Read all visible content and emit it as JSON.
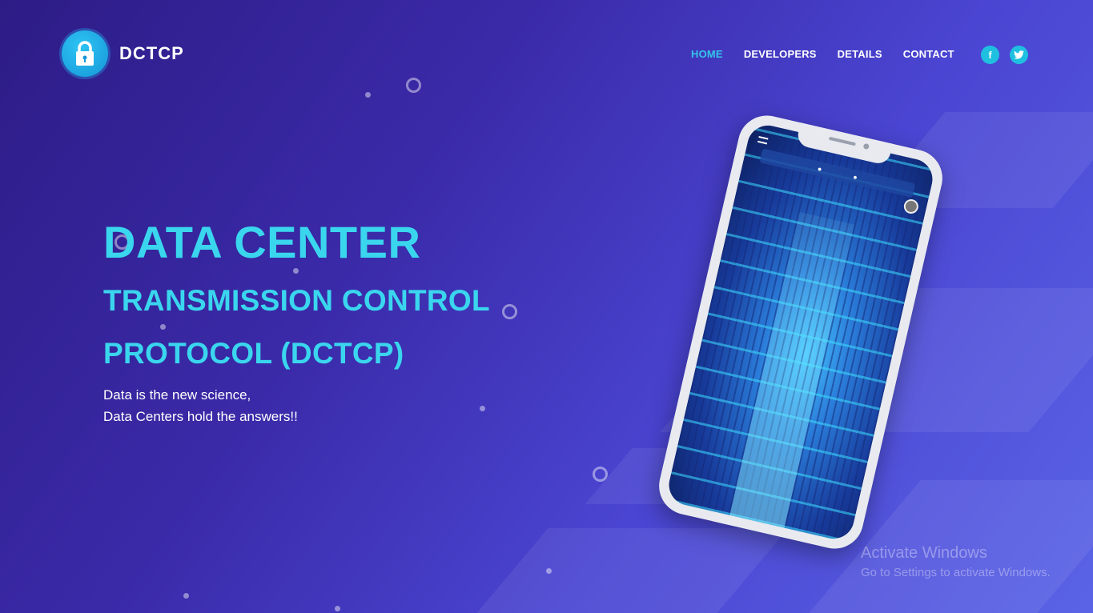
{
  "brand": {
    "name": "DCTCP",
    "logo_icon": "lock-icon"
  },
  "nav": {
    "items": [
      {
        "label": "HOME",
        "active": true
      },
      {
        "label": "DEVELOPERS",
        "active": false
      },
      {
        "label": "DETAILS",
        "active": false
      },
      {
        "label": "CONTACT",
        "active": false
      }
    ]
  },
  "social": {
    "facebook": "f",
    "twitter": "t"
  },
  "hero": {
    "title": "DATA CENTER",
    "subtitle_line1": "TRANSMISSION CONTROL",
    "subtitle_line2": "PROTOCOL (DCTCP)",
    "tagline_line1": "Data is the new science,",
    "tagline_line2": "Data Centers hold the answers!!"
  },
  "watermark": {
    "line1": "Activate Windows",
    "line2": "Go to Settings to activate Windows."
  },
  "colors": {
    "accent": "#3ad6ee",
    "nav_active": "#34c6ea",
    "social_bg": "#1fbfe0",
    "bg_start": "#2d1c86",
    "bg_end": "#5a63e6"
  }
}
